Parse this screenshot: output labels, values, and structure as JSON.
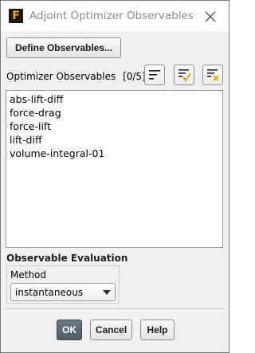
{
  "window": {
    "title": "Adjoint Optimizer Observables",
    "icon": "fluent-app-icon"
  },
  "toolbar": {
    "define_label": "Define Observables..."
  },
  "list": {
    "label": "Optimizer Observables",
    "count": "[0/5]",
    "items": [
      "abs-lift-diff",
      "force-drag",
      "force-lift",
      "lift-diff",
      "volume-integral-01"
    ]
  },
  "evaluation": {
    "section_title": "Observable Evaluation",
    "method_label": "Method",
    "method_value": "instantaneous"
  },
  "buttons": {
    "ok": "OK",
    "cancel": "Cancel",
    "help": "Help"
  },
  "colors": {
    "ok_button": "#5a6874",
    "select_all_check": "#e8a317",
    "deselect_x": "#e8a317"
  }
}
